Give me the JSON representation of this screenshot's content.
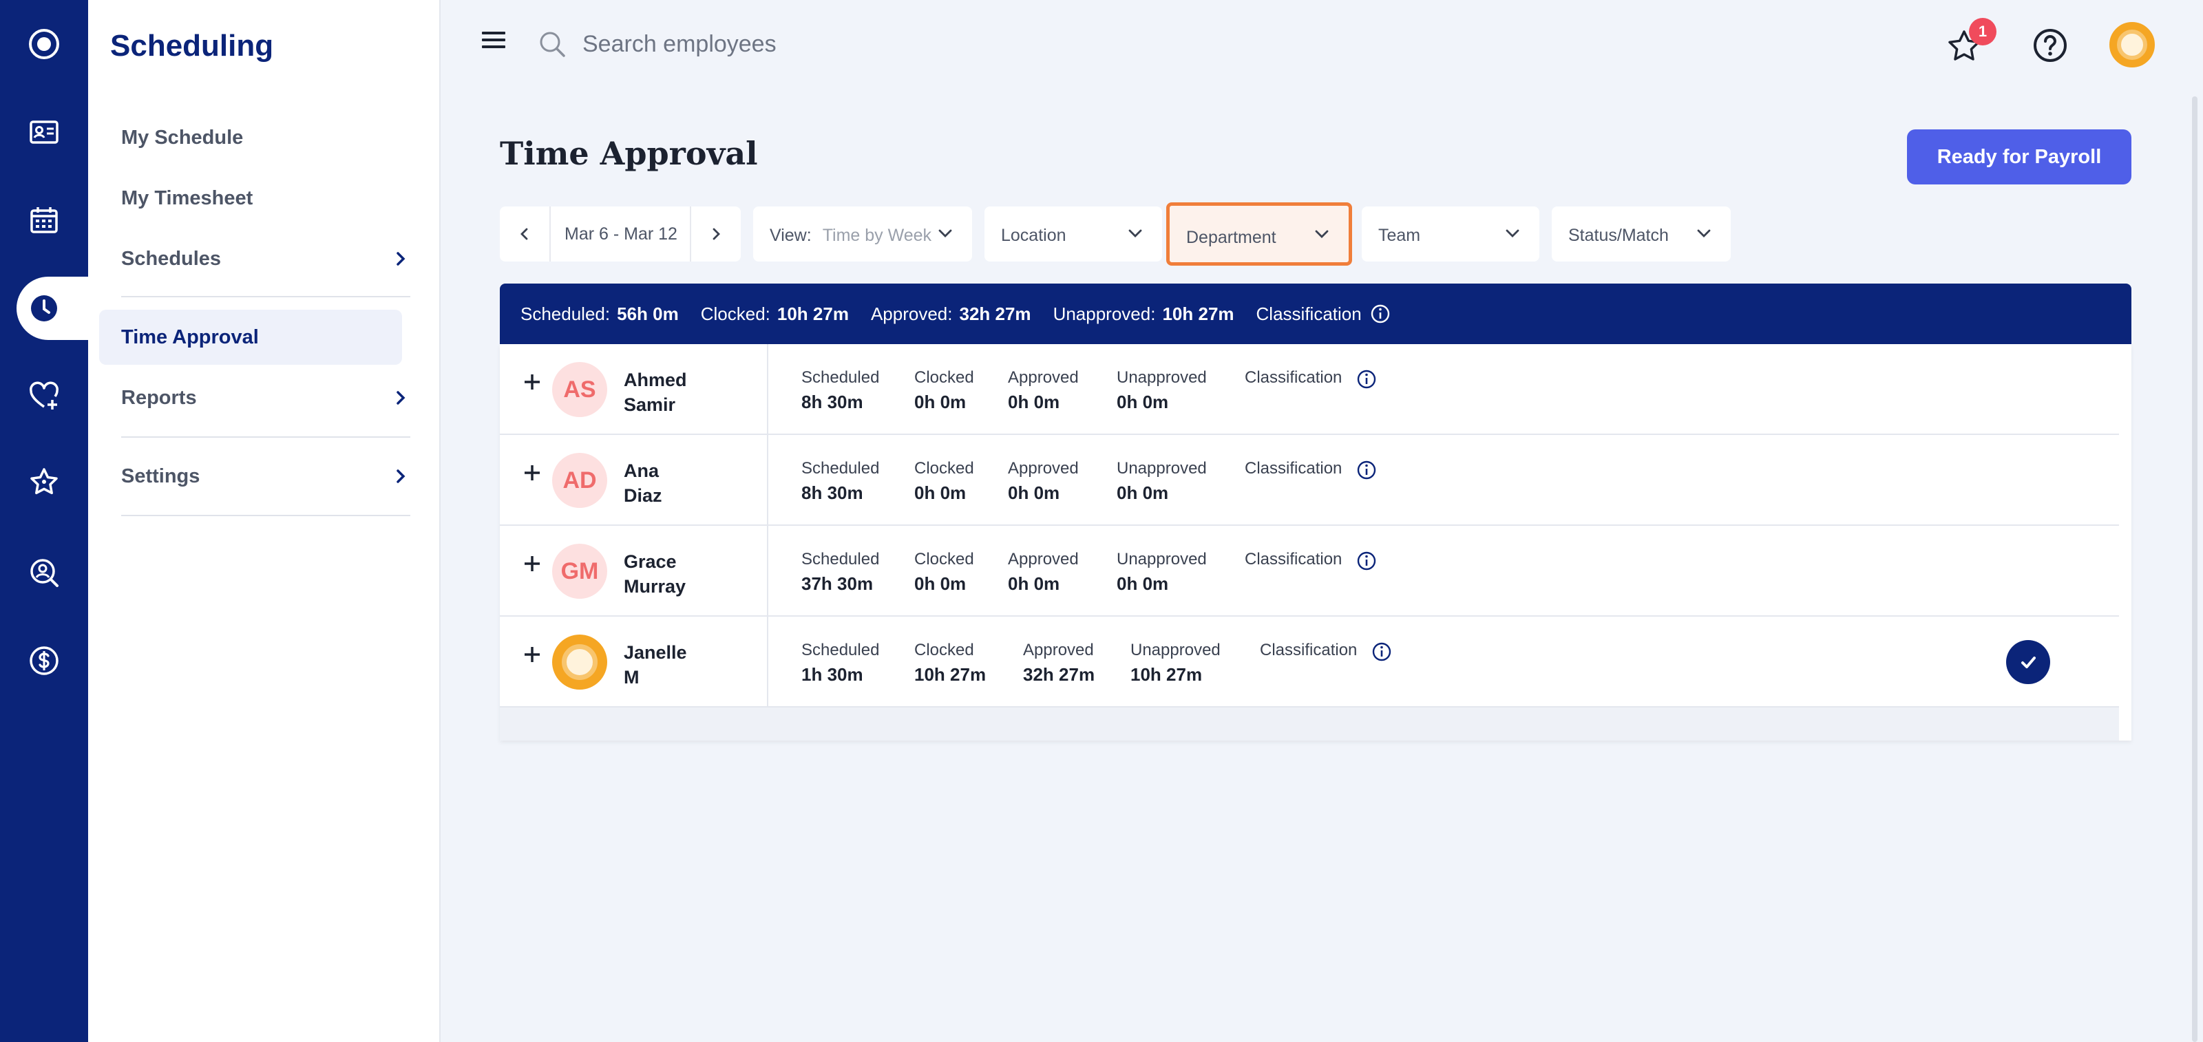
{
  "app": {
    "title": "Scheduling"
  },
  "colors": {
    "brand": "#0b2479",
    "accent": "#4f5fe8",
    "highlight": "#f07e3a",
    "badge": "#f04b5c"
  },
  "rail": {
    "icons": [
      "app-logo-icon",
      "profile-card-icon",
      "calendar-icon",
      "clock-icon",
      "heart-plus-icon",
      "star-icon",
      "search-person-icon",
      "dollar-icon"
    ],
    "active": "clock-icon"
  },
  "nav": {
    "items": [
      {
        "label": "My Schedule"
      },
      {
        "label": "My Timesheet"
      },
      {
        "label": "Schedules"
      },
      {
        "label": "Time Approval"
      },
      {
        "label": "Reports"
      },
      {
        "label": "Settings"
      }
    ],
    "active": "Time Approval"
  },
  "topbar": {
    "search_placeholder": "Search employees",
    "notification_count": "1"
  },
  "page": {
    "title": "Time Approval",
    "payroll_button": "Ready for Payroll"
  },
  "filters": {
    "date_range": "Mar 6 - Mar 12",
    "view_label": "View:",
    "view_value": "Time by Week",
    "location": "Location",
    "department": "Department",
    "team": "Team",
    "status": "Status/Match"
  },
  "summary": {
    "scheduled_label": "Scheduled:",
    "scheduled": "56h 0m",
    "clocked_label": "Clocked:",
    "clocked": "10h 27m",
    "approved_label": "Approved:",
    "approved": "32h 27m",
    "unapproved_label": "Unapproved:",
    "unapproved": "10h 27m",
    "classification_label": "Classification"
  },
  "columns": {
    "scheduled": "Scheduled",
    "clocked": "Clocked",
    "approved": "Approved",
    "unapproved": "Unapproved",
    "classification": "Classification"
  },
  "employees": [
    {
      "initials": "AS",
      "first": "Ahmed",
      "last": "Samir",
      "scheduled": "8h 30m",
      "clocked": "0h 0m",
      "approved": "0h 0m",
      "unapproved": "0h 0m"
    },
    {
      "initials": "AD",
      "first": "Ana",
      "last": "Diaz",
      "scheduled": "8h 30m",
      "clocked": "0h 0m",
      "approved": "0h 0m",
      "unapproved": "0h 0m"
    },
    {
      "initials": "GM",
      "first": "Grace",
      "last": "Murray",
      "scheduled": "37h 30m",
      "clocked": "0h 0m",
      "approved": "0h 0m",
      "unapproved": "0h 0m"
    },
    {
      "initials": "",
      "first": "Janelle",
      "last": "M",
      "scheduled": "1h 30m",
      "clocked": "10h 27m",
      "approved": "32h 27m",
      "unapproved": "10h 27m"
    }
  ]
}
